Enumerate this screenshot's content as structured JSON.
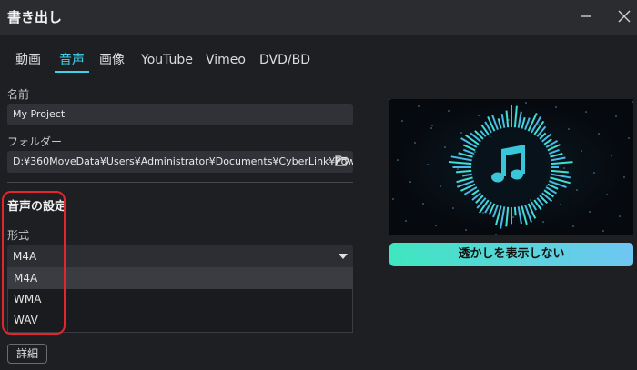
{
  "window": {
    "title": "書き出し",
    "minimize_glyph": "—",
    "close_glyph": "✕"
  },
  "tabs": [
    {
      "label": "動画",
      "active": false
    },
    {
      "label": "音声",
      "active": true
    },
    {
      "label": "画像",
      "active": false
    },
    {
      "label": "YouTube",
      "active": false
    },
    {
      "label": "Vimeo",
      "active": false
    },
    {
      "label": "DVD/BD",
      "active": false
    }
  ],
  "name": {
    "label": "名前",
    "value": "My Project"
  },
  "folder": {
    "label": "フォルダー",
    "value": "D:¥360MoveData¥Users¥Administrator¥Documents¥CyberLink¥PowerDir...",
    "icon": "folder-open-icon"
  },
  "audio_settings": {
    "title": "音声の設定",
    "format_label": "形式",
    "format_selected": "M4A",
    "options": [
      "M4A",
      "WMA",
      "WAV"
    ]
  },
  "details_button": "詳細",
  "preview": {
    "icon": "music-note-icon"
  },
  "watermark_button": "透かしを表示しない",
  "colors": {
    "accent": "#3fd2ea",
    "highlight_border": "#e3262d",
    "background": "#1d1f23",
    "button_gradient_start": "#3fe6c0",
    "button_gradient_end": "#6fc6f3"
  }
}
